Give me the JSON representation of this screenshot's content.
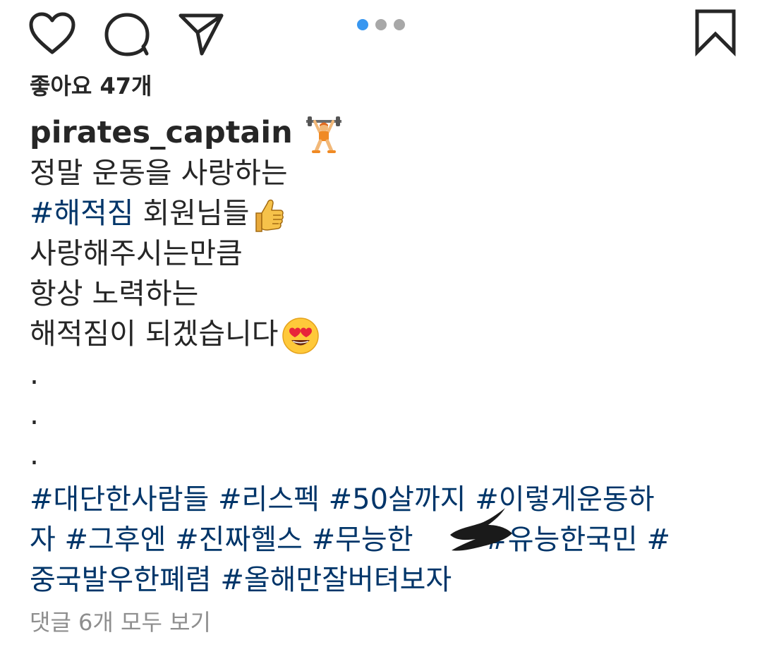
{
  "actions": {
    "like_icon": "heart-outline",
    "comment_icon": "speech-bubble-outline",
    "share_icon": "paper-plane-outline",
    "bookmark_icon": "bookmark-outline",
    "carousel": {
      "total": 3,
      "active_index": 0,
      "active_color": "#3897f0",
      "inactive_color": "#a8a8a8"
    }
  },
  "likes": {
    "text": "좋아요 47개"
  },
  "caption": {
    "username": "pirates_captain",
    "username_emoji": "person-lifting-weights",
    "lines": [
      {
        "text": "정말 운동을 사랑하는"
      },
      {
        "hashtag": "#해적짐",
        "text": " 회원님들",
        "emoji": "thumbs-up"
      },
      {
        "text": "사랑해주시는만큼"
      },
      {
        "text": "항상 노력하는"
      },
      {
        "text": "해적짐이 되겠습니다",
        "emoji": "heart-eyes"
      }
    ],
    "dots": [
      ".",
      ".",
      "."
    ]
  },
  "hashtags": {
    "line1": "#대단한사람들 #리스펙 #50살까지 #이렇게운동하",
    "line2_a": "자 #그후엔 #진짜헬스 #무능한",
    "line2_b": " #유능한국민 #",
    "line3": "중국발우한폐렴 #올해만잘버텨보자"
  },
  "comments": {
    "view_all": "댓글 6개 모두 보기"
  },
  "colors": {
    "hashtag": "#003569",
    "text": "#262626",
    "muted": "#8e8e8e"
  }
}
